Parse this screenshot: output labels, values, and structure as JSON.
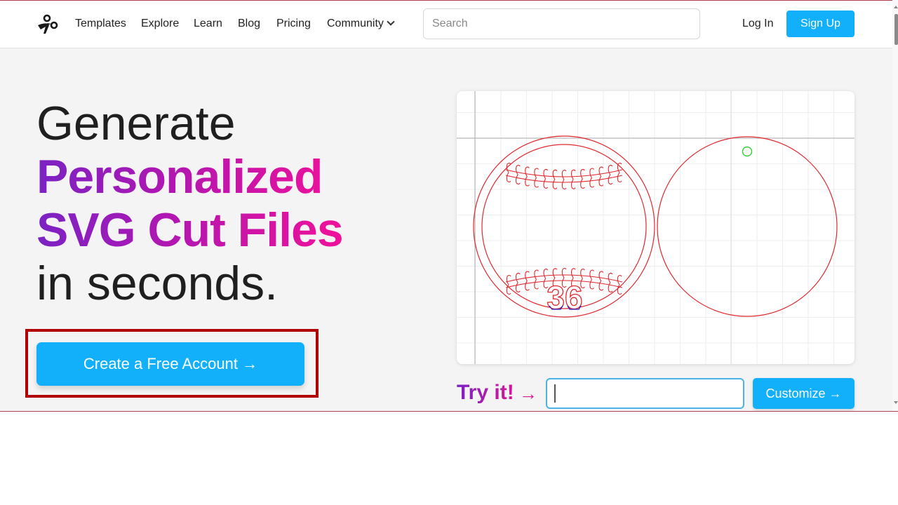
{
  "header": {
    "logo_icon": "scissors-icon",
    "nav": [
      {
        "label": "Templates"
      },
      {
        "label": "Explore"
      },
      {
        "label": "Learn"
      },
      {
        "label": "Blog"
      },
      {
        "label": "Pricing"
      },
      {
        "label": "Community",
        "has_dropdown": true
      }
    ],
    "search": {
      "placeholder": "Search",
      "value": ""
    },
    "login_label": "Log In",
    "signup_label": "Sign Up"
  },
  "hero": {
    "line1": "Generate",
    "line2": "Personalized",
    "line3": "SVG Cut Files",
    "line4": "in seconds.",
    "cta_label": "Create a Free Account →"
  },
  "preview": {
    "number_text": "36",
    "cut_color": "#e0282e",
    "accent_color": "#2020d0",
    "hole_color": "#22cc22"
  },
  "try_it": {
    "label": "Try it!",
    "arrow": "→",
    "input_value": "",
    "customize_label": "Customize →"
  },
  "colors": {
    "brand_blue": "#12b0fb",
    "gradient_start": "#7b22c4",
    "gradient_end": "#f0119a",
    "highlight_frame": "#b00000"
  }
}
